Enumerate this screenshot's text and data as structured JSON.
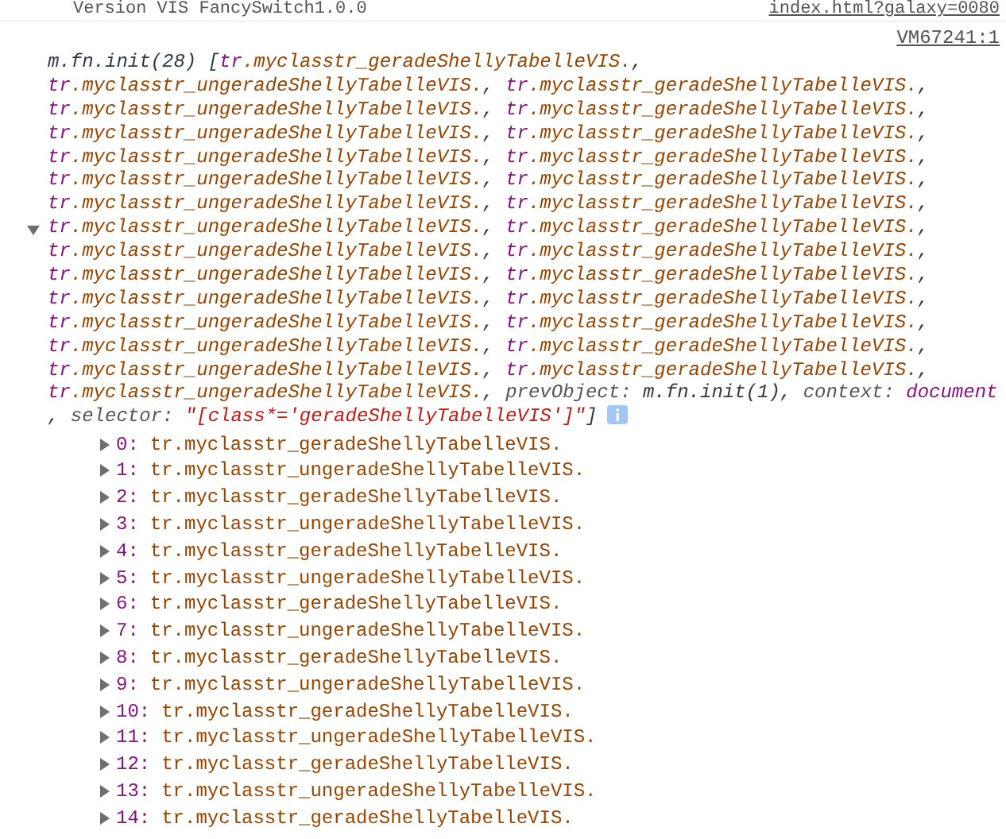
{
  "previous_message": {
    "text": "Version VIS FancySwitch1.0.0",
    "source": "index.html?galaxy=0080"
  },
  "message": {
    "source": "VM67241:1",
    "expanded": true,
    "preview": {
      "head": "m.fn.init(28) [",
      "separator": ",",
      "tail": "]",
      "items": [
        {
          "tag": "tr",
          "cls": ".myclasstr_geradeShellyTabelleVIS."
        },
        {
          "tag": "tr",
          "cls": ".myclasstr_ungeradeShellyTabelleVIS."
        },
        {
          "tag": "tr",
          "cls": ".myclasstr_geradeShellyTabelleVIS."
        },
        {
          "tag": "tr",
          "cls": ".myclasstr_ungeradeShellyTabelleVIS."
        },
        {
          "tag": "tr",
          "cls": ".myclasstr_geradeShellyTabelleVIS."
        },
        {
          "tag": "tr",
          "cls": ".myclasstr_ungeradeShellyTabelleVIS."
        },
        {
          "tag": "tr",
          "cls": ".myclasstr_geradeShellyTabelleVIS."
        },
        {
          "tag": "tr",
          "cls": ".myclasstr_ungeradeShellyTabelleVIS."
        },
        {
          "tag": "tr",
          "cls": ".myclasstr_geradeShellyTabelleVIS."
        },
        {
          "tag": "tr",
          "cls": ".myclasstr_ungeradeShellyTabelleVIS."
        },
        {
          "tag": "tr",
          "cls": ".myclasstr_geradeShellyTabelleVIS."
        },
        {
          "tag": "tr",
          "cls": ".myclasstr_ungeradeShellyTabelleVIS."
        },
        {
          "tag": "tr",
          "cls": ".myclasstr_geradeShellyTabelleVIS."
        },
        {
          "tag": "tr",
          "cls": ".myclasstr_ungeradeShellyTabelleVIS."
        },
        {
          "tag": "tr",
          "cls": ".myclasstr_geradeShellyTabelleVIS."
        },
        {
          "tag": "tr",
          "cls": ".myclasstr_ungeradeShellyTabelleVIS."
        },
        {
          "tag": "tr",
          "cls": ".myclasstr_geradeShellyTabelleVIS."
        },
        {
          "tag": "tr",
          "cls": ".myclasstr_ungeradeShellyTabelleVIS."
        },
        {
          "tag": "tr",
          "cls": ".myclasstr_geradeShellyTabelleVIS."
        },
        {
          "tag": "tr",
          "cls": ".myclasstr_ungeradeShellyTabelleVIS."
        },
        {
          "tag": "tr",
          "cls": ".myclasstr_geradeShellyTabelleVIS."
        },
        {
          "tag": "tr",
          "cls": ".myclasstr_ungeradeShellyTabelleVIS."
        },
        {
          "tag": "tr",
          "cls": ".myclasstr_geradeShellyTabelleVIS."
        },
        {
          "tag": "tr",
          "cls": ".myclasstr_ungeradeShellyTabelleVIS."
        },
        {
          "tag": "tr",
          "cls": ".myclasstr_geradeShellyTabelleVIS."
        },
        {
          "tag": "tr",
          "cls": ".myclasstr_ungeradeShellyTabelleVIS."
        },
        {
          "tag": "tr",
          "cls": ".myclasstr_geradeShellyTabelleVIS."
        },
        {
          "tag": "tr",
          "cls": ".myclasstr_ungeradeShellyTabelleVIS."
        }
      ],
      "props": [
        {
          "key": "prevObject:",
          "value": "m.fn.init(1)",
          "kind": "object"
        },
        {
          "key": "context:",
          "value": "document",
          "kind": "element"
        },
        {
          "key": "selector:",
          "value": "\"[class*='geradeShellyTabelleVIS']\"",
          "kind": "string"
        }
      ]
    },
    "entries": [
      {
        "index": "0:",
        "value": "tr.myclasstr_geradeShellyTabelleVIS.",
        "expanded": false
      },
      {
        "index": "1:",
        "value": "tr.myclasstr_ungeradeShellyTabelleVIS.",
        "expanded": false
      },
      {
        "index": "2:",
        "value": "tr.myclasstr_geradeShellyTabelleVIS.",
        "expanded": false
      },
      {
        "index": "3:",
        "value": "tr.myclasstr_ungeradeShellyTabelleVIS.",
        "expanded": false
      },
      {
        "index": "4:",
        "value": "tr.myclasstr_geradeShellyTabelleVIS.",
        "expanded": false
      },
      {
        "index": "5:",
        "value": "tr.myclasstr_ungeradeShellyTabelleVIS.",
        "expanded": false
      },
      {
        "index": "6:",
        "value": "tr.myclasstr_geradeShellyTabelleVIS.",
        "expanded": false
      },
      {
        "index": "7:",
        "value": "tr.myclasstr_ungeradeShellyTabelleVIS.",
        "expanded": false
      },
      {
        "index": "8:",
        "value": "tr.myclasstr_geradeShellyTabelleVIS.",
        "expanded": false
      },
      {
        "index": "9:",
        "value": "tr.myclasstr_ungeradeShellyTabelleVIS.",
        "expanded": false
      },
      {
        "index": "10:",
        "value": "tr.myclasstr_geradeShellyTabelleVIS.",
        "expanded": false
      },
      {
        "index": "11:",
        "value": "tr.myclasstr_ungeradeShellyTabelleVIS.",
        "expanded": false
      },
      {
        "index": "12:",
        "value": "tr.myclasstr_geradeShellyTabelleVIS.",
        "expanded": false
      },
      {
        "index": "13:",
        "value": "tr.myclasstr_ungeradeShellyTabelleVIS.",
        "expanded": false
      },
      {
        "index": "14:",
        "value": "tr.myclasstr_geradeShellyTabelleVIS.",
        "expanded": false
      }
    ]
  }
}
